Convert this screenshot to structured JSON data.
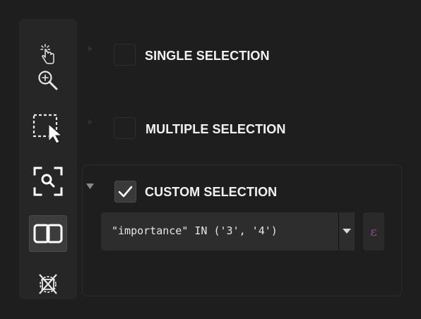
{
  "toolbar": {
    "tools": [
      {
        "icon": "pointer-hand-icon"
      },
      {
        "icon": "zoom-in-icon"
      },
      {
        "icon": "select-rectangle-icon"
      },
      {
        "icon": "zoom-to-selection-icon"
      },
      {
        "icon": "linked-selection-icon",
        "active": true
      },
      {
        "icon": "clear-selection-icon"
      }
    ]
  },
  "options": {
    "single": {
      "label": "SINGLE SELECTION",
      "checked": false
    },
    "multiple": {
      "label": "MULTIPLE SELECTION",
      "checked": false
    },
    "custom": {
      "label": "CUSTOM SELECTION",
      "checked": true,
      "expression": "\"importance\" IN ('3', '4')",
      "expression_button_glyph": "ε"
    }
  },
  "colors": {
    "background": "#1e1e1e",
    "toolbar": "#262626",
    "accent_epsilon": "#8a4f8f"
  }
}
